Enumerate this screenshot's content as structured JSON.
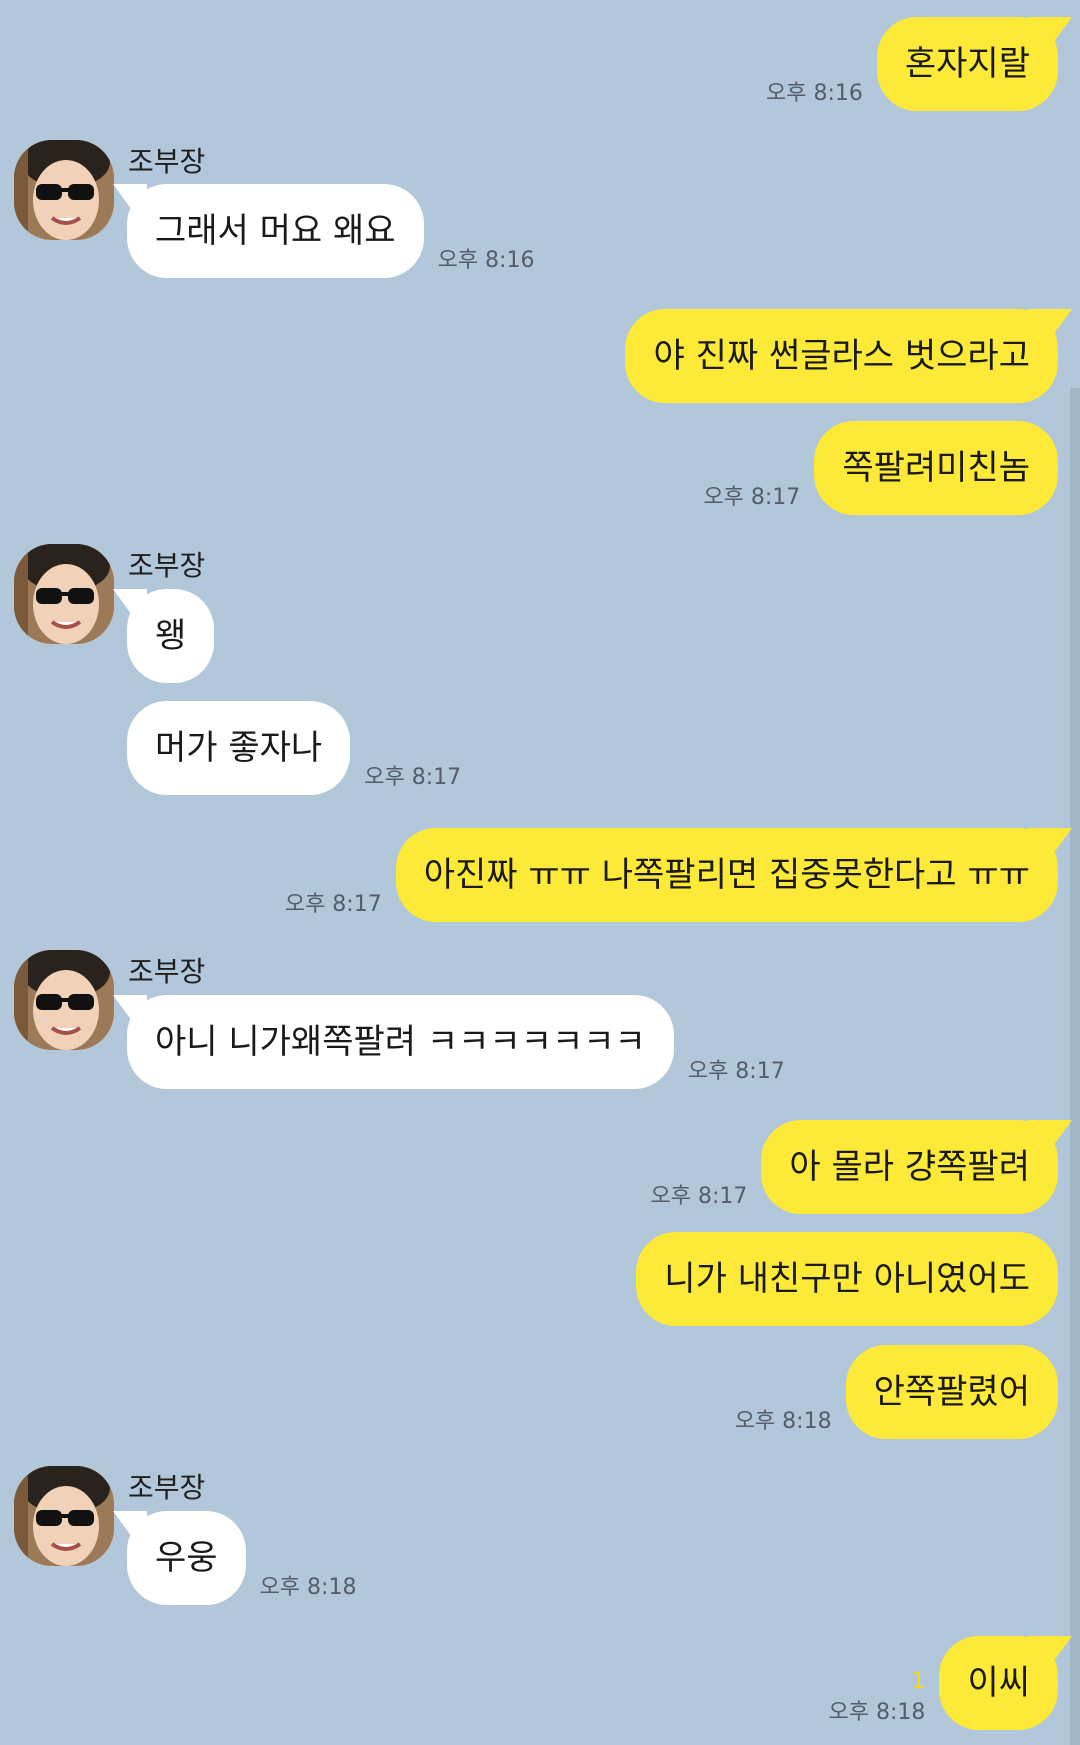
{
  "sender_name": "조부장",
  "messages": [
    {
      "id": "m1",
      "from": "me",
      "text": "혼자지랄",
      "time": "오후 8:16"
    },
    {
      "id": "m2",
      "from": "other",
      "text": "그래서 머요 왜요",
      "time": "오후 8:16"
    },
    {
      "id": "m3",
      "from": "me",
      "text": "야 진짜 썬글라스 벗으라고",
      "time": ""
    },
    {
      "id": "m4",
      "from": "me",
      "text": "쪽팔려미친놈",
      "time": "오후 8:17"
    },
    {
      "id": "m5",
      "from": "other",
      "text": "왱",
      "time": ""
    },
    {
      "id": "m6",
      "from": "other",
      "text": "머가 좋자나",
      "time": "오후 8:17"
    },
    {
      "id": "m7",
      "from": "me",
      "text": "아진짜 ㅠㅠ 나쪽팔리면 집중못한다고 ㅠㅠ",
      "time": "오후 8:17"
    },
    {
      "id": "m8",
      "from": "other",
      "text": "아니 니가왜쪽팔려 ㅋㅋㅋㅋㅋㅋㅋ",
      "time": "오후 8:17"
    },
    {
      "id": "m9",
      "from": "me",
      "text": "아 몰라 걍쪽팔려",
      "time": "오후 8:17"
    },
    {
      "id": "m10",
      "from": "me",
      "text": "니가 내친구만 아니였어도",
      "time": ""
    },
    {
      "id": "m11",
      "from": "me",
      "text": "안쪽팔렸어",
      "time": "오후 8:18"
    },
    {
      "id": "m12",
      "from": "other",
      "text": "우웅",
      "time": "오후 8:18"
    },
    {
      "id": "m13",
      "from": "me",
      "text": "이씨",
      "time": "오후 8:18",
      "unread": "1"
    }
  ],
  "colors": {
    "background": "#b2c7d9",
    "my_bubble": "#fdea38",
    "their_bubble": "#ffffff",
    "unread": "#f7d51b"
  },
  "icons": {
    "profile": "profile-photo-sunglasses"
  }
}
